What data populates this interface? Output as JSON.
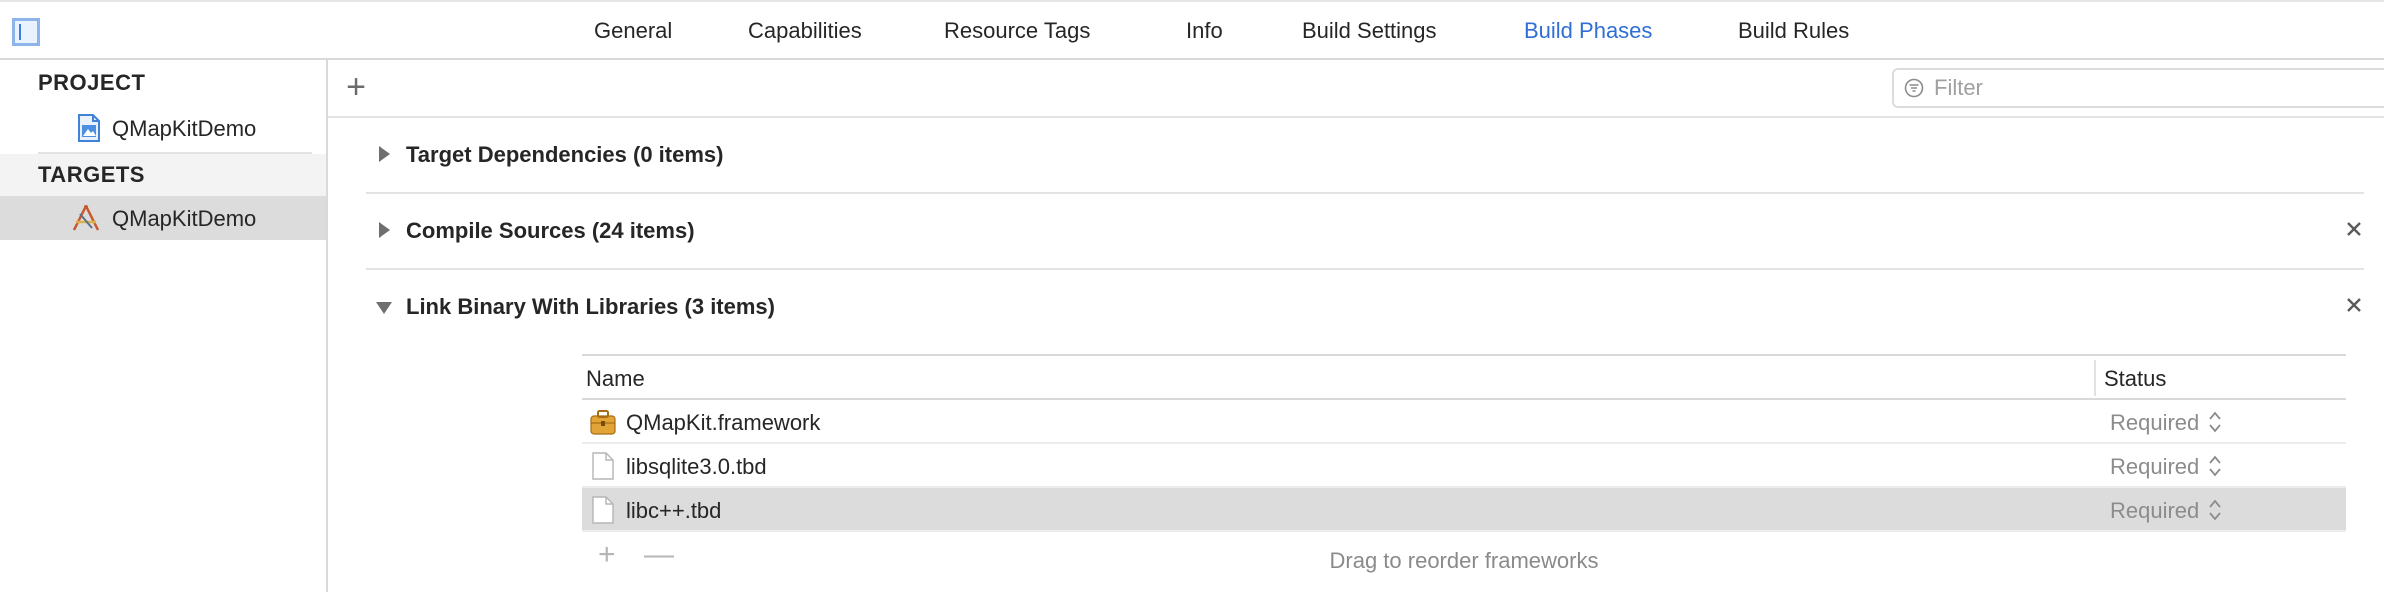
{
  "tabs": [
    {
      "label": "General",
      "active": false
    },
    {
      "label": "Capabilities",
      "active": false
    },
    {
      "label": "Resource Tags",
      "active": false
    },
    {
      "label": "Info",
      "active": false
    },
    {
      "label": "Build Settings",
      "active": false
    },
    {
      "label": "Build Phases",
      "active": true
    },
    {
      "label": "Build Rules",
      "active": false
    }
  ],
  "sidebar": {
    "project_header": "PROJECT",
    "project_item": "QMapKitDemo",
    "targets_header": "TARGETS",
    "target_item": "QMapKitDemo"
  },
  "toolbar": {
    "add_label": "+",
    "filter_placeholder": "Filter"
  },
  "phases": [
    {
      "title": "Target Dependencies (0 items)",
      "expanded": false,
      "closable": false
    },
    {
      "title": "Compile Sources (24 items)",
      "expanded": false,
      "closable": true
    },
    {
      "title": "Link Binary With Libraries (3 items)",
      "expanded": true,
      "closable": true
    }
  ],
  "libraries": {
    "col_name": "Name",
    "col_status": "Status",
    "rows": [
      {
        "name": "QMapKit.framework",
        "status": "Required",
        "icon": "framework-icon",
        "selected": false
      },
      {
        "name": "libsqlite3.0.tbd",
        "status": "Required",
        "icon": "file-icon",
        "selected": false
      },
      {
        "name": "libc++.tbd",
        "status": "Required",
        "icon": "file-icon",
        "selected": true
      }
    ],
    "add_label": "+",
    "remove_label": "—",
    "hint": "Drag to reorder frameworks"
  },
  "colors": {
    "accent": "#2f6fd6",
    "selection": "#dcdcdc"
  }
}
